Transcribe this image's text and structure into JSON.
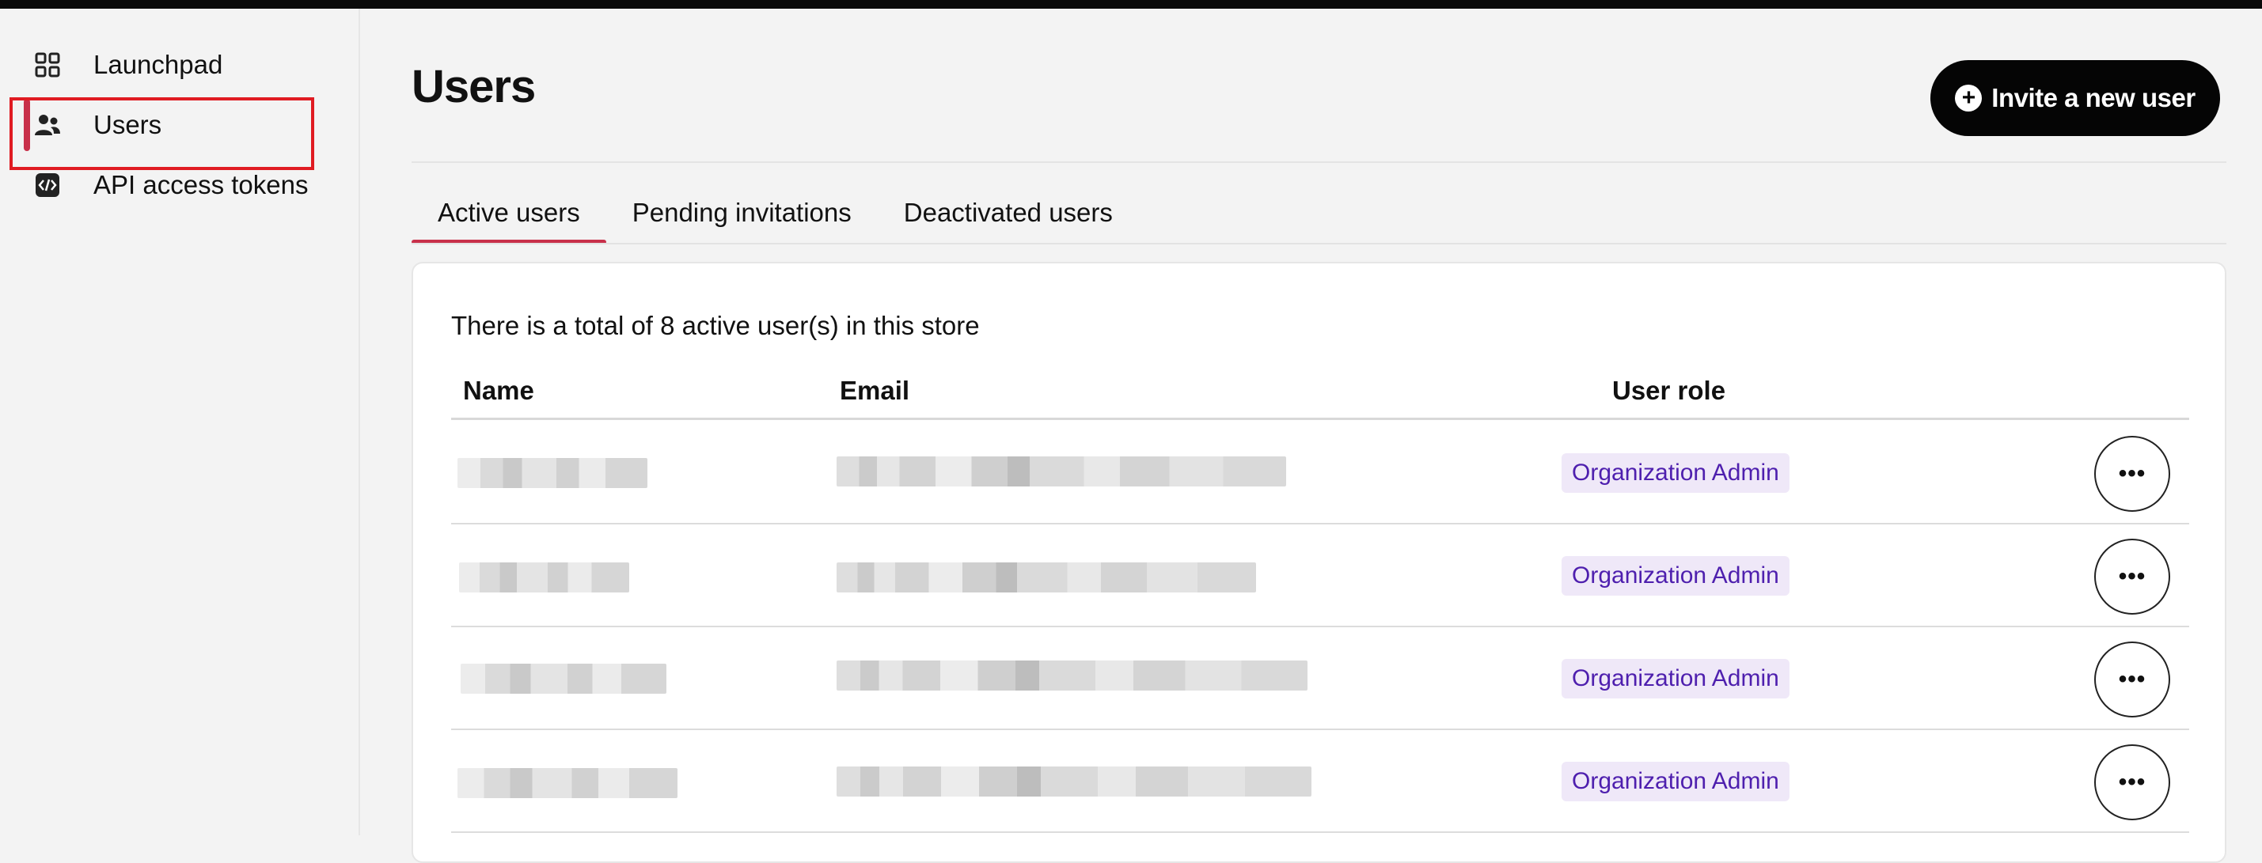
{
  "sidebar": {
    "items": [
      {
        "label": "Launchpad",
        "icon": "grid-icon"
      },
      {
        "label": "Users",
        "icon": "users-icon",
        "active": true
      },
      {
        "label": "API access tokens",
        "icon": "code-icon"
      }
    ]
  },
  "header": {
    "title": "Users",
    "invite_button_label": "Invite a new user"
  },
  "tabs": [
    {
      "label": "Active users",
      "active": true
    },
    {
      "label": "Pending invitations"
    },
    {
      "label": "Deactivated users"
    }
  ],
  "table": {
    "summary": "There is a total of 8 active user(s) in this store",
    "columns": [
      "Name",
      "Email",
      "User role"
    ],
    "rows": [
      {
        "role": "Organization Admin",
        "actions": "•••"
      },
      {
        "role": "Organization Admin",
        "actions": "•••"
      },
      {
        "role": "Organization Admin",
        "actions": "•••"
      },
      {
        "role": "Organization Admin",
        "actions": "•••"
      }
    ]
  },
  "colors": {
    "accent": "#c8304a",
    "badge_bg": "#efe8f8",
    "badge_text": "#4e1fae",
    "highlight": "#e01b22"
  }
}
